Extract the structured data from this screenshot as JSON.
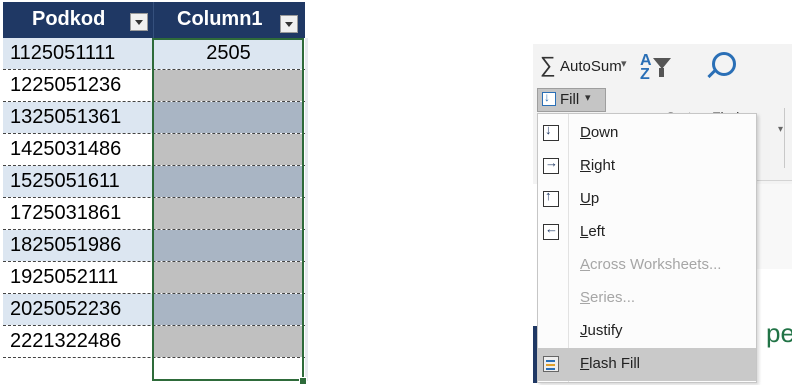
{
  "table": {
    "headers": [
      "Podkod",
      "Column1"
    ],
    "rows": [
      {
        "podkod": "1125051111",
        "column1": "2505"
      },
      {
        "podkod": "1225051236",
        "column1": ""
      },
      {
        "podkod": "1325051361",
        "column1": ""
      },
      {
        "podkod": "1425031486",
        "column1": ""
      },
      {
        "podkod": "1525051611",
        "column1": ""
      },
      {
        "podkod": "1725031861",
        "column1": ""
      },
      {
        "podkod": "1825051986",
        "column1": ""
      },
      {
        "podkod": "1925052111",
        "column1": ""
      },
      {
        "podkod": "2025052236",
        "column1": ""
      },
      {
        "podkod": "2221322486",
        "column1": ""
      }
    ]
  },
  "ribbon": {
    "autosum_label": "AutoSum",
    "fill_label": "Fill",
    "sort_filter_label": "Sort & Filter",
    "find_select_label": "Find & Select",
    "caret": "▾"
  },
  "fill_menu": {
    "items": [
      {
        "label": "Down",
        "accel": "D",
        "icon": "fill-down-icon",
        "enabled": true
      },
      {
        "label": "Right",
        "accel": "R",
        "icon": "fill-right-icon",
        "enabled": true
      },
      {
        "label": "Up",
        "accel": "U",
        "icon": "fill-up-icon",
        "enabled": true
      },
      {
        "label": "Left",
        "accel": "L",
        "icon": "fill-left-icon",
        "enabled": true
      },
      {
        "label": "Across Worksheets...",
        "accel": "A",
        "icon": "",
        "enabled": false
      },
      {
        "label": "Series...",
        "accel": "S",
        "icon": "",
        "enabled": false
      },
      {
        "label": "Justify",
        "accel": "J",
        "icon": "",
        "enabled": true
      },
      {
        "label": "Flash Fill",
        "accel": "F",
        "icon": "flash-fill-icon",
        "enabled": true,
        "hovered": true
      }
    ]
  },
  "background_text": "pe",
  "colors": {
    "header_bg": "#1f3864",
    "band_light": "#dce6f1",
    "selection_border": "#2e6b3a",
    "excel_green": "#217346"
  }
}
